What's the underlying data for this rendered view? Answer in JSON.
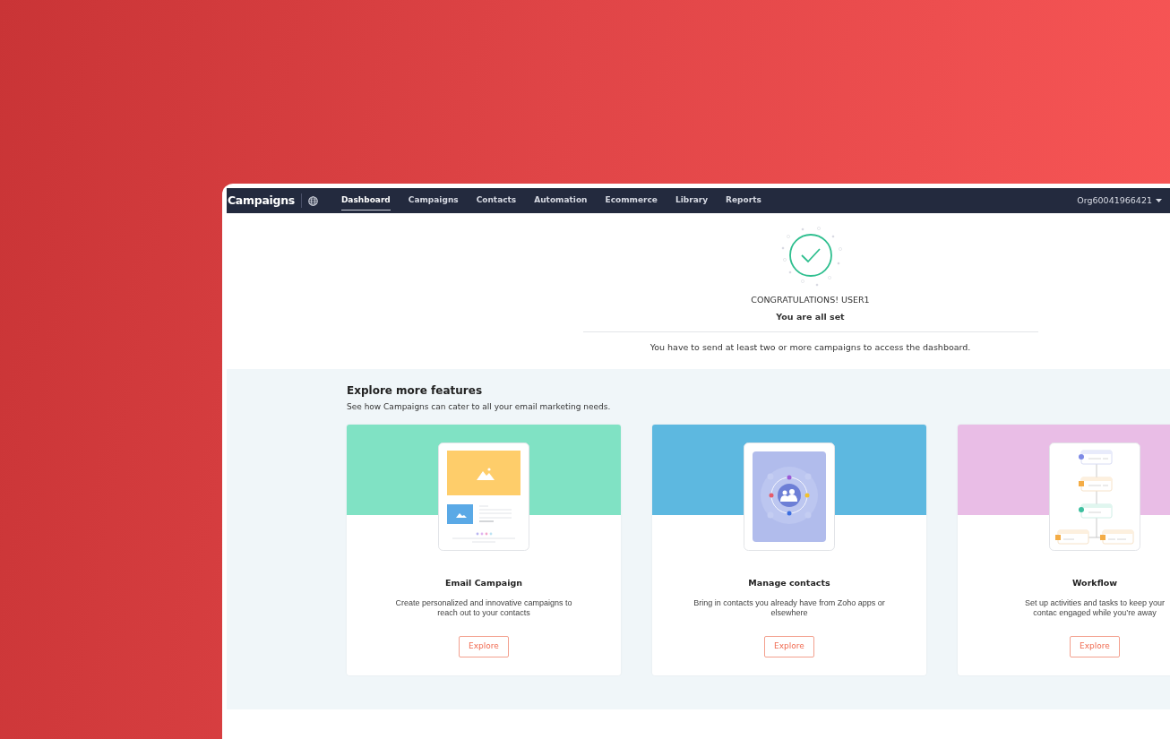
{
  "navbar": {
    "logo": "Campaigns",
    "items": [
      {
        "label": "Dashboard",
        "selected": true
      },
      {
        "label": "Campaigns",
        "selected": false
      },
      {
        "label": "Contacts",
        "selected": false
      },
      {
        "label": "Automation",
        "selected": false
      },
      {
        "label": "Ecommerce",
        "selected": false
      },
      {
        "label": "Library",
        "selected": false
      },
      {
        "label": "Reports",
        "selected": false
      }
    ],
    "org_menu": "Org60041966421"
  },
  "hero": {
    "title": "CONGRATULATIONS! USER1",
    "subtitle": "You are all set",
    "message": "You have to send at least two or more campaigns to access the dashboard."
  },
  "features": {
    "title": "Explore more features",
    "subtitle": "See how Campaigns can cater to all your email marketing needs.",
    "cards": [
      {
        "kind": "email",
        "color": "#80e2c4",
        "title": "Email Campaign",
        "description": "Create personalized and innovative campaigns to reach out to your contacts",
        "button": "Explore"
      },
      {
        "kind": "contacts",
        "color": "#5db8e0",
        "title": "Manage contacts",
        "description": "Bring in contacts you already have from Zoho apps or elsewhere",
        "button": "Explore"
      },
      {
        "kind": "workflow",
        "color": "#e9bde6",
        "title": "Workflow",
        "description": "Set up activities and tasks to keep your contac engaged while you’re away",
        "button": "Explore"
      }
    ]
  }
}
